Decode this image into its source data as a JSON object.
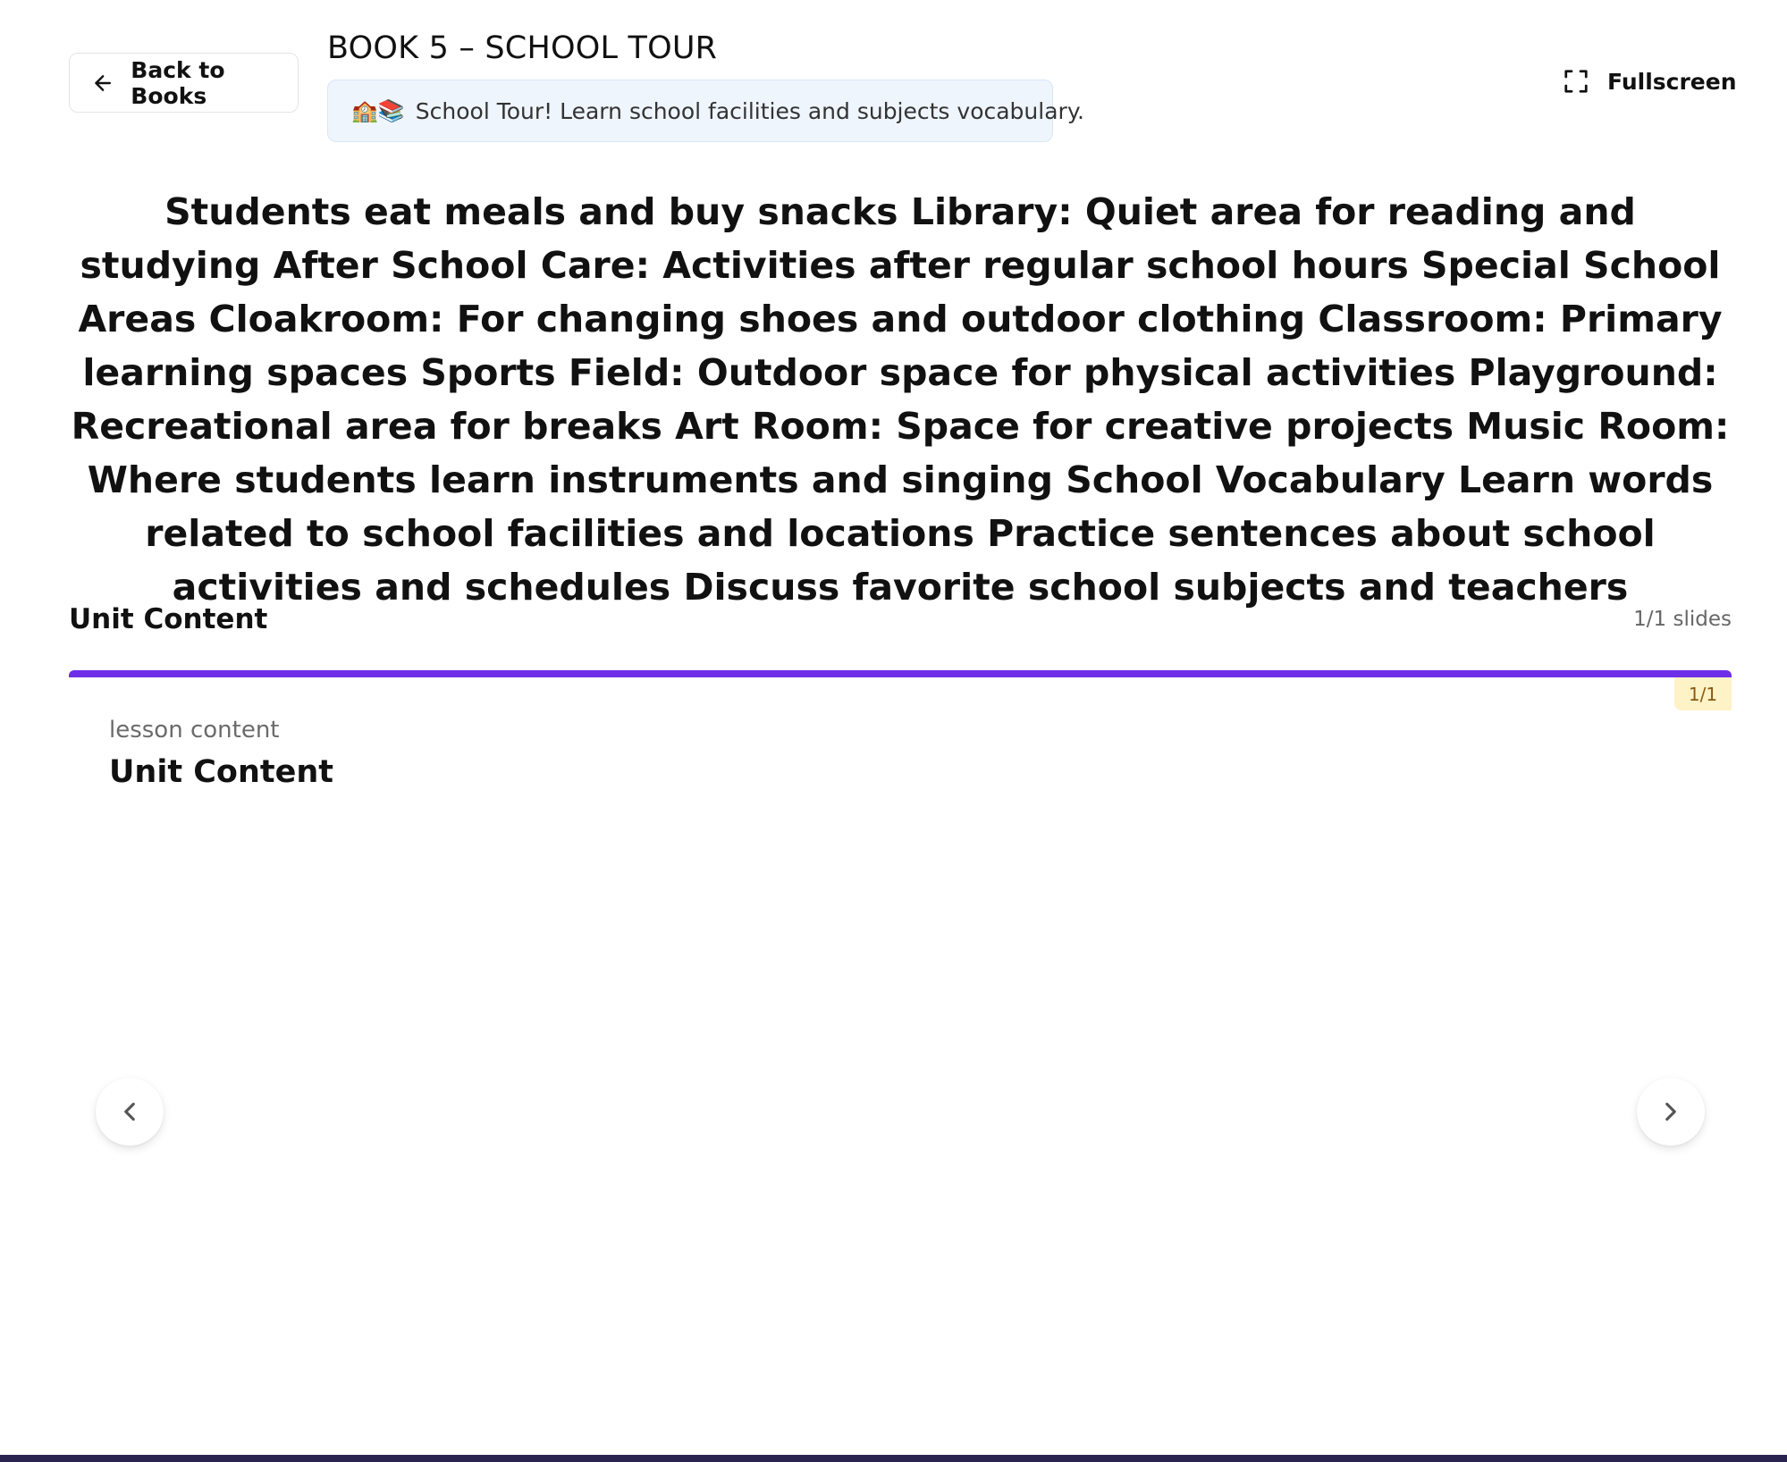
{
  "header": {
    "back_label": "Back to Books",
    "book_title": "BOOK 5 – SCHOOL TOUR",
    "tagline_emoji": "🏫📚",
    "tagline_text": "School Tour! Learn school facilities and subjects vocabulary.",
    "fullscreen_label": "Fullscreen"
  },
  "description": "Students eat meals and buy snacks Library: Quiet area for reading and studying After School Care: Activities after regular school hours Special School Areas Cloakroom: For changing shoes and outdoor clothing Classroom: Primary learning spaces Sports Field: Outdoor space for physical activities Playground: Recreational area for breaks Art Room: Space for creative projects Music Room: Where students learn instruments and singing School Vocabulary Learn words related to school facilities and locations Practice sentences about school activities and schedules Discuss favorite school subjects and teachers",
  "unit": {
    "title": "Unit Content",
    "slides_count": "1/1 slides"
  },
  "slide": {
    "progress": 1.0,
    "badge": "1/1",
    "label": "lesson content",
    "title": "Unit Content"
  },
  "colors": {
    "accent": "#6d2ee8",
    "badge_bg": "#fef3c7",
    "tagline_bg": "#eff5fd"
  },
  "icons": {
    "back": "arrow-left-icon",
    "fullscreen": "fullscreen-icon",
    "prev": "chevron-left-icon",
    "next": "chevron-right-icon"
  }
}
